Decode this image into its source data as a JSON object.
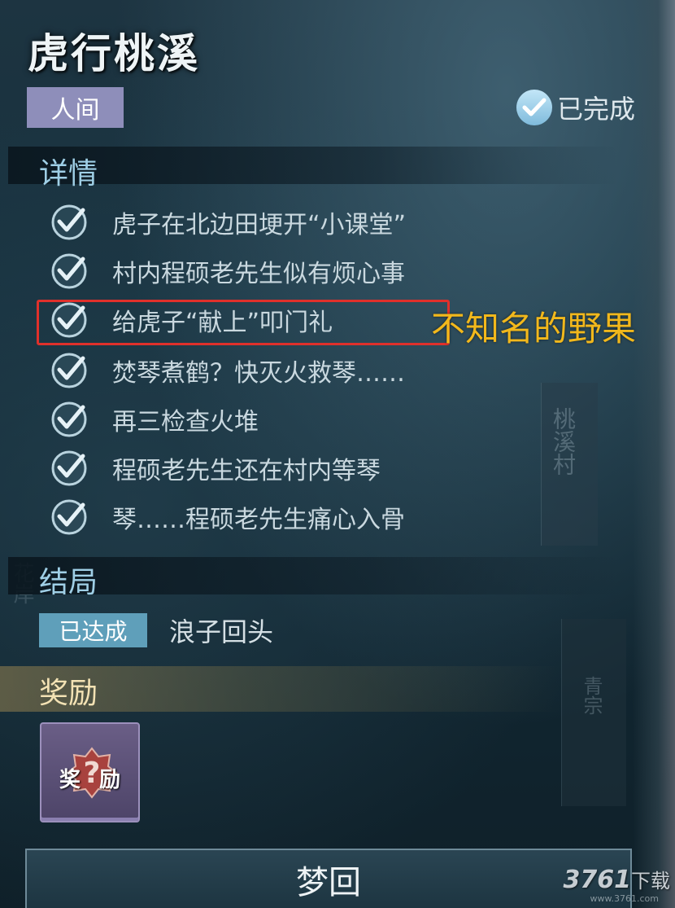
{
  "quest": {
    "title": "虎行桃溪",
    "category_tag": "人间",
    "status_label": "已完成"
  },
  "details": {
    "heading": "详情",
    "tasks": [
      {
        "text": "虎子在北边田埂开“小课堂”",
        "completed": true
      },
      {
        "text": "村内程硕老先生似有烦心事",
        "completed": true
      },
      {
        "text": "给虎子“献上”叩门礼",
        "completed": true
      },
      {
        "text": "焚琴煮鹤？快灭火救琴……",
        "completed": true
      },
      {
        "text": "再三检查火堆",
        "completed": true
      },
      {
        "text": "程硕老先生还在村内等琴",
        "completed": true
      },
      {
        "text": "琴……程硕老先生痛心入骨",
        "completed": true
      }
    ]
  },
  "annotation": {
    "text": "不知名的野果",
    "color": "#f2b81c",
    "box_color": "#e0302b"
  },
  "ending": {
    "heading": "结局",
    "badge": "已达成",
    "name": "浪子回头"
  },
  "reward": {
    "heading": "奖励",
    "item_chars": [
      "奖",
      "励"
    ],
    "item_icon": "question-mark-icon"
  },
  "dream_button_label": "梦回",
  "background": {
    "side_text_1": "桃溪村",
    "side_text_2": "青宗",
    "left_text": "花岸"
  },
  "watermark": {
    "brand": "3761",
    "suffix": "下载",
    "url": "www.3761.com"
  },
  "colors": {
    "panel_bg": "#16303d",
    "tag_bg": "#8e8eba",
    "achieved_bg": "#5f9fba",
    "section_title": "#9fcfe6"
  }
}
